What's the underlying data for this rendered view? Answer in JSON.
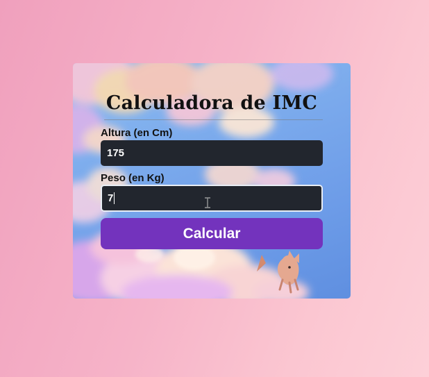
{
  "app": {
    "title": "Calculadora de IMC"
  },
  "form": {
    "altura": {
      "label": "Altura (en Cm)",
      "value": "175"
    },
    "peso": {
      "label": "Peso (en Kg)",
      "value": "7"
    },
    "submit_label": "Calcular"
  },
  "colors": {
    "page_background": "#f6b3c8",
    "input_background": "#22262e",
    "button_background": "#7333bd",
    "card_sky": "#7aa9ec"
  },
  "icons": {
    "cursor": "text-cursor-icon",
    "illustration": "fox-illustration"
  }
}
